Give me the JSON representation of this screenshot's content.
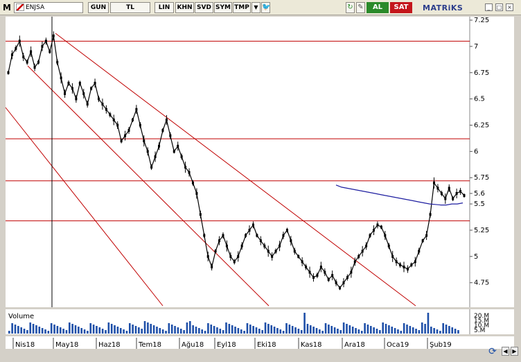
{
  "toolbar": {
    "logo": "M",
    "symbol": "ENJSA",
    "buttons": [
      "GUN",
      "TL",
      "LIN",
      "KHN",
      "SVD",
      "SYM",
      "TMP"
    ],
    "dropdown_icon": "chevron-down-icon",
    "twitter_icon": "bird-icon",
    "action_icons": [
      "refresh-icon",
      "pin-icon"
    ],
    "buy_label": "AL",
    "sell_label": "SAT",
    "brand": "MATRiKS",
    "window_buttons": [
      "minimize-icon",
      "maximize-icon",
      "close-icon"
    ]
  },
  "colors": {
    "price": "#000000",
    "channel": "#c00000",
    "hline": "#c00000",
    "moving_average": "#1e1ea0",
    "volume": "#1e4fa8",
    "background": "#ffffff"
  },
  "chart_data": {
    "type": "line",
    "symbol": "ENJSA",
    "price_axis_ticks": [
      "7.25",
      "7",
      "6.75",
      "6.5",
      "6.25",
      "6",
      "5.75",
      "5.6",
      "5.5",
      "5.25",
      "5",
      "4.75"
    ],
    "ylim": [
      4.53,
      7.27
    ],
    "time_labels": [
      "Nis18",
      "May18",
      "Haz18",
      "Tem18",
      "Ağu18",
      "Eyl18",
      "Eki18",
      "Kas18",
      "Ara18",
      "Oca19",
      "Şub19"
    ],
    "horizontal_levels": [
      7.05,
      6.12,
      5.72,
      5.34
    ],
    "series": [
      {
        "values": [
          6.75,
          6.92,
          6.98,
          7.05,
          6.9,
          6.85,
          6.95,
          6.8,
          6.85,
          7.0,
          7.05,
          6.95,
          7.1,
          6.85,
          6.7,
          6.55,
          6.65,
          6.6,
          6.5,
          6.65,
          6.55,
          6.45,
          6.6,
          6.65,
          6.5,
          6.45,
          6.4,
          6.35,
          6.3,
          6.25,
          6.1,
          6.15,
          6.2,
          6.3,
          6.4,
          6.25,
          6.1,
          6.0,
          5.85,
          5.95,
          6.05,
          6.2,
          6.3,
          6.15,
          6.0,
          6.05,
          5.95,
          5.85,
          5.8,
          5.7,
          5.6,
          5.4,
          5.2,
          5.0,
          4.9,
          5.05,
          5.15,
          5.2,
          5.1,
          5.0,
          4.95,
          5.0,
          5.1,
          5.2,
          5.25,
          5.3,
          5.2,
          5.15,
          5.1,
          5.05,
          5.0,
          5.05,
          5.1,
          5.2,
          5.25,
          5.15,
          5.05,
          5.0,
          4.95,
          4.9,
          4.85,
          4.8,
          4.82,
          4.9,
          4.85,
          4.78,
          4.82,
          4.75,
          4.7,
          4.75,
          4.8,
          4.85,
          4.95,
          5.0,
          5.05,
          5.1,
          5.2,
          5.25,
          5.3,
          5.28,
          5.2,
          5.1,
          5.0,
          4.95,
          4.92,
          4.9,
          4.88,
          4.92,
          4.95,
          5.05,
          5.15,
          5.2,
          5.4,
          5.7,
          5.65,
          5.6,
          5.55,
          5.65,
          5.55,
          5.6,
          5.62,
          5.58
        ]
      },
      {
        "values": [
          5.68,
          5.66,
          5.65,
          5.64,
          5.63,
          5.62,
          5.61,
          5.6,
          5.59,
          5.58,
          5.57,
          5.56,
          5.55,
          5.54,
          5.53,
          5.52,
          5.51,
          5.5,
          5.495,
          5.49,
          5.49,
          5.5,
          5.5,
          5.51
        ]
      }
    ],
    "volume_axis_ticks": [
      "20.M",
      "15.M",
      "10.M",
      "5.M"
    ],
    "volume_label": "Volume",
    "ylabel": "",
    "xlabel": ""
  }
}
